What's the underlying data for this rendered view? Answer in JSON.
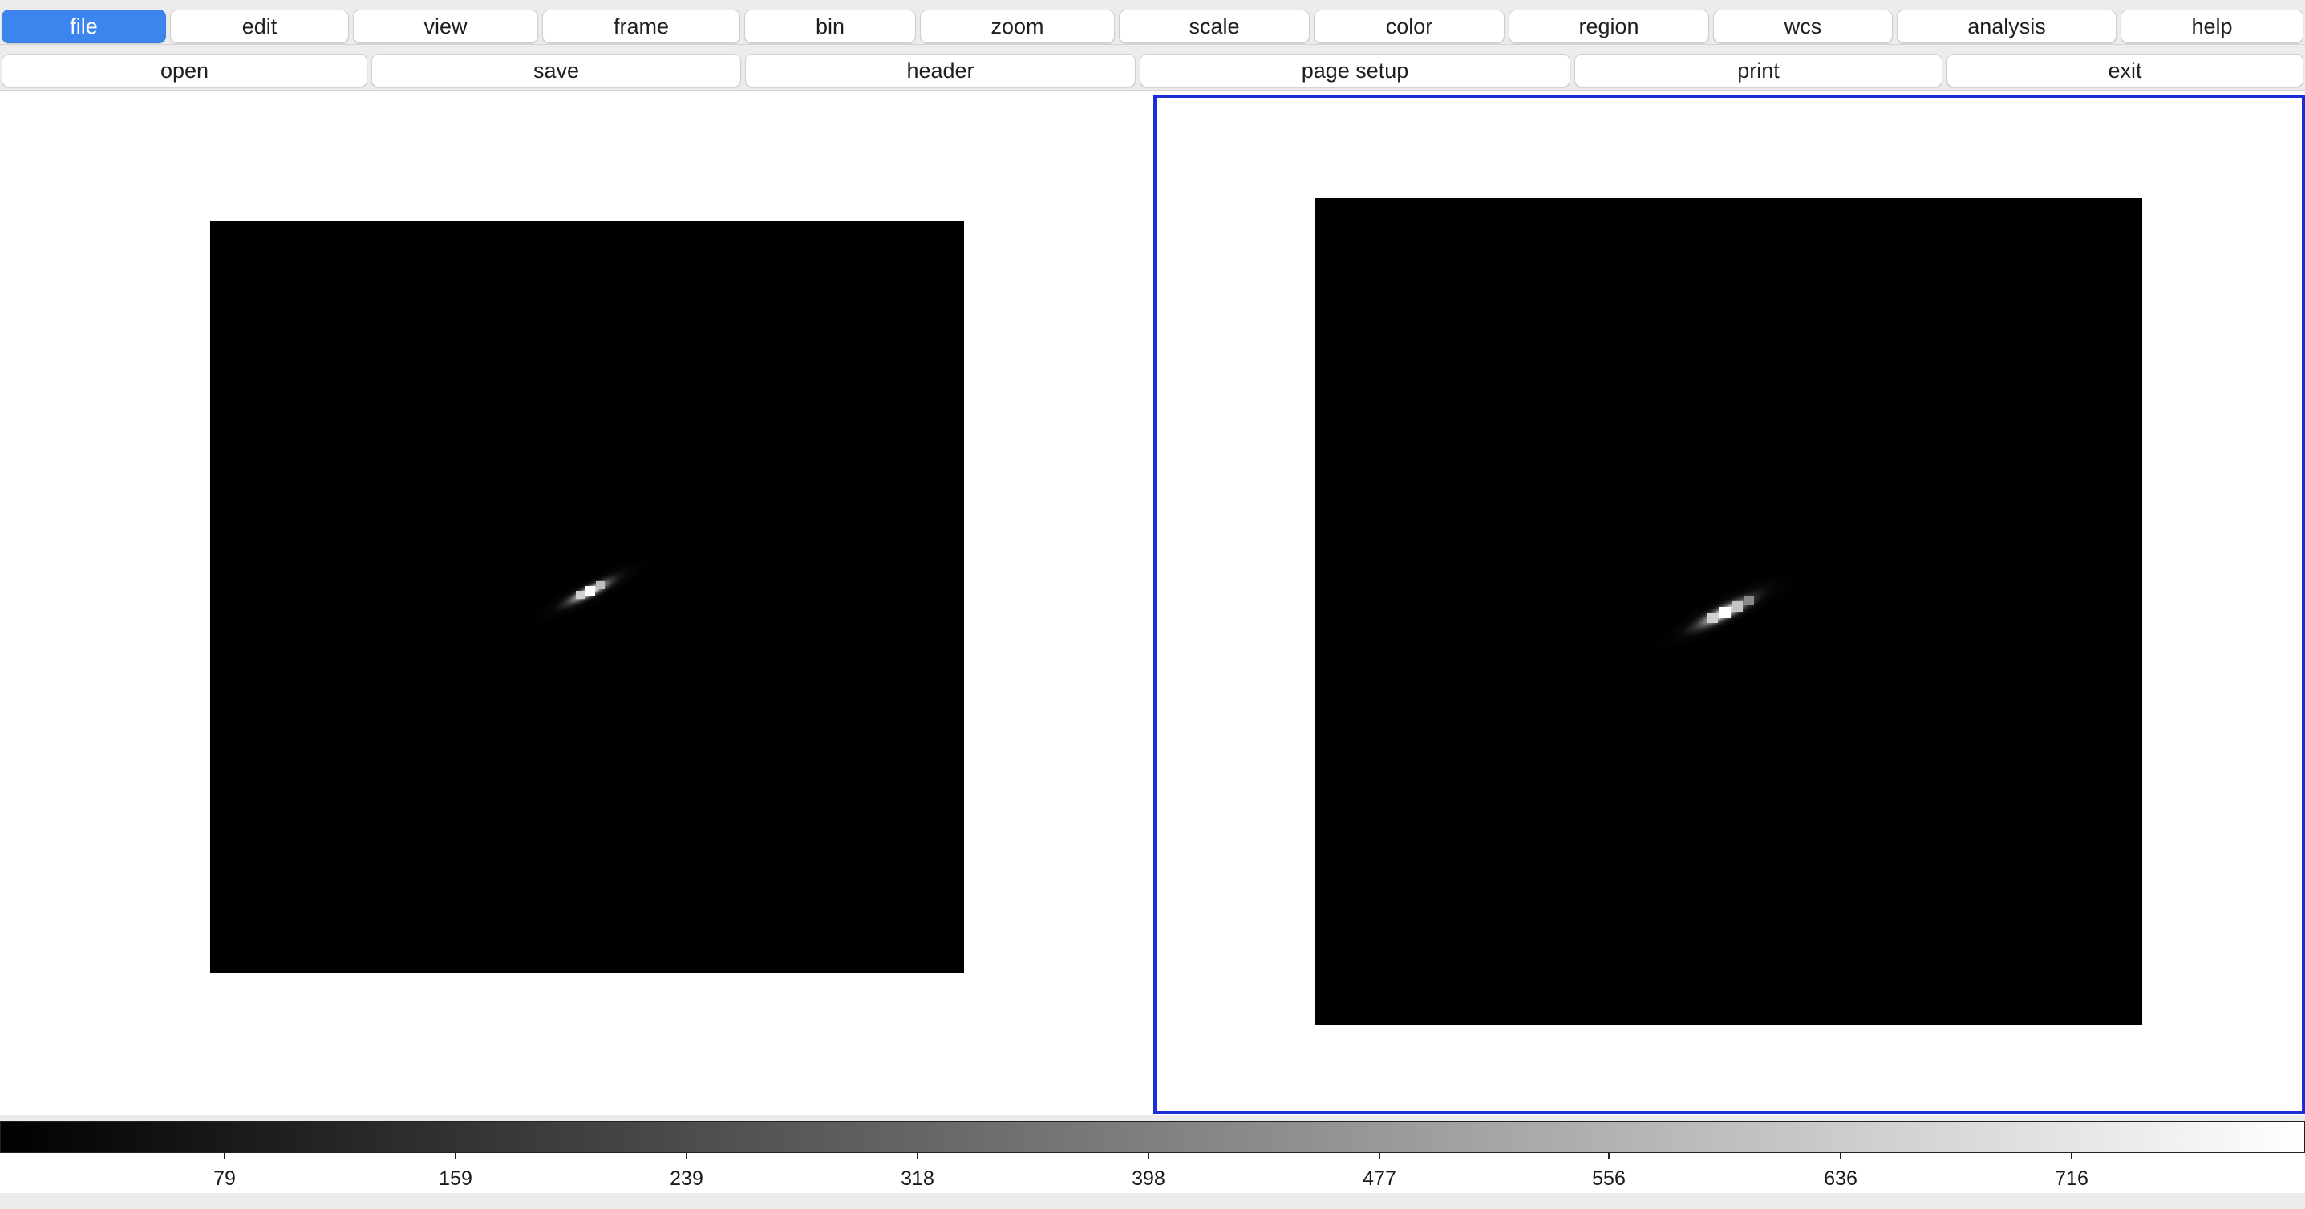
{
  "menubar": {
    "items": [
      {
        "label": "file",
        "active": true
      },
      {
        "label": "edit"
      },
      {
        "label": "view"
      },
      {
        "label": "frame"
      },
      {
        "label": "bin"
      },
      {
        "label": "zoom"
      },
      {
        "label": "scale"
      },
      {
        "label": "color"
      },
      {
        "label": "region"
      },
      {
        "label": "wcs"
      },
      {
        "label": "analysis"
      },
      {
        "label": "help"
      }
    ]
  },
  "submenu": {
    "items": [
      {
        "label": "open"
      },
      {
        "label": "save"
      },
      {
        "label": "header"
      },
      {
        "label": "page setup"
      },
      {
        "label": "print"
      },
      {
        "label": "exit"
      }
    ]
  },
  "colors": {
    "accent": "#3d85ee",
    "current_frame_border": "#1a2fd6",
    "image_background": "#000000"
  },
  "frames": [
    {
      "current": false
    },
    {
      "current": true
    }
  ],
  "colorbar": {
    "colormap": "grey",
    "ticks": [
      "79",
      "159",
      "239",
      "318",
      "398",
      "477",
      "556",
      "636",
      "716"
    ]
  }
}
